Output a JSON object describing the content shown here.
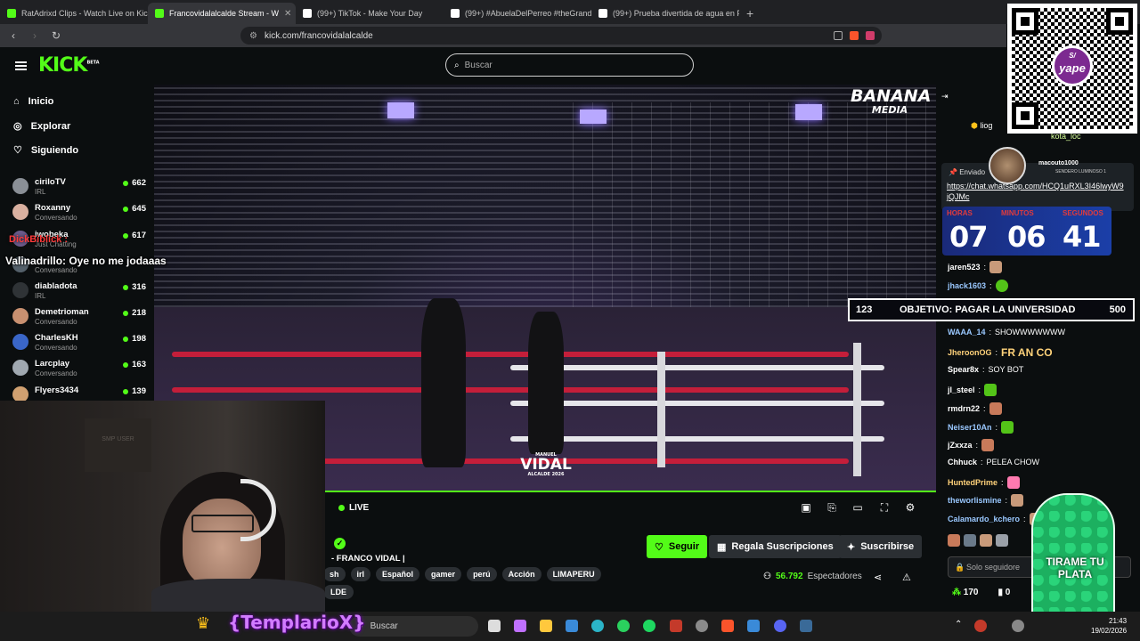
{
  "browser": {
    "tabs": [
      {
        "title": "RatAdrixd Clips - Watch Live on Kick",
        "color": "#53fc18",
        "active": false
      },
      {
        "title": "Francovidalalcalde Stream - W",
        "color": "#53fc18",
        "active": true
      },
      {
        "title": "(99+) TikTok - Make Your Day",
        "color": "#ffffff",
        "active": false
      },
      {
        "title": "(99+) #AbuelaDelPerreo #theGrandm",
        "color": "#ffffff",
        "active": false
      },
      {
        "title": "(99+) Prueba divertida de agua en Pe",
        "color": "#ffffff",
        "active": false
      }
    ],
    "url": "kick.com/francovidalalcalde"
  },
  "kick": {
    "logo": "KICK",
    "logo_badge": "BETA",
    "search_placeholder": "Buscar",
    "nav": [
      {
        "label": "Inicio",
        "icon": "home-icon"
      },
      {
        "label": "Explorar",
        "icon": "compass-icon"
      },
      {
        "label": "Siguiendo",
        "icon": "heart-icon"
      }
    ],
    "channels": [
      {
        "name": "ciriloTV",
        "sub": "IRL",
        "viewers": "662",
        "color": "#8a8f96"
      },
      {
        "name": "Roxanny",
        "sub": "Conversando",
        "viewers": "645",
        "color": "#d9b0a0"
      },
      {
        "name": "iwobeka",
        "sub": "Just Chatting",
        "viewers": "617",
        "color": "#6a5a8a"
      },
      {
        "name": "",
        "sub": "Conversando",
        "viewers": "",
        "color": "#54606a"
      },
      {
        "name": "diabladota",
        "sub": "IRL",
        "viewers": "316",
        "color": "#2f3336"
      },
      {
        "name": "Demetrioman",
        "sub": "Conversando",
        "viewers": "218",
        "color": "#c89070"
      },
      {
        "name": "CharlesKH",
        "sub": "Conversando",
        "viewers": "198",
        "color": "#3a66c8"
      },
      {
        "name": "Larcplay",
        "sub": "Conversando",
        "viewers": "163",
        "color": "#a0a8b0"
      },
      {
        "name": "Flyers3434",
        "sub": "",
        "viewers": "139",
        "color": "#d0a070"
      }
    ]
  },
  "video": {
    "watermark_top": "BANANA",
    "watermark_bottom": "MEDIA",
    "vidal_small_top": "MANUEL",
    "vidal_big": "VIDAL",
    "vidal_small_bottom": "ALCALDE 2026",
    "live_label": "LIVE"
  },
  "stream": {
    "title": "- FRANCO VIDAL |",
    "tags": [
      "sh",
      "irl",
      "Español",
      "gamer",
      "perú",
      "Acción",
      "LIMAPERU"
    ],
    "tag_extra": "LDE",
    "follow": "Seguir",
    "gift": "Regala Suscripciones",
    "subscribe": "Suscribirse",
    "viewers": "56.792",
    "viewers_label": "Espectadores"
  },
  "chat": {
    "pinned_header": "Enviado",
    "pinned_link": "https://chat.whatsapp.com/HCQ1uRXL3I46lwyW9jQJMc",
    "top_user": "liog",
    "top_user2": "kota_loc",
    "messages": [
      {
        "user": "jaren523",
        "text": "",
        "color": "#ffffff",
        "emote": "#c89a7a"
      },
      {
        "user": "jhack1603",
        "text": "",
        "color": "#9ac8ff",
        "emote": "#53c418"
      },
      {
        "user": "WAAA_14",
        "text": "SHOWWWWWWW",
        "color": "#9ac8ff",
        "emote": ""
      },
      {
        "user": "JheroonOG",
        "text": "FR AN CO",
        "color": "#ffd27a",
        "emote": ""
      },
      {
        "user": "Spear8x",
        "text": "SOY BOT",
        "color": "#ffffff",
        "emote": ""
      },
      {
        "user": "jl_steel",
        "text": "",
        "color": "#ffffff",
        "emote": "#53c418"
      },
      {
        "user": "rmdrn22",
        "text": "",
        "color": "#ffffff",
        "emote": "#c87a5a"
      },
      {
        "user": "Neiser10An",
        "text": "",
        "color": "#9ac8ff",
        "emote": "#53c418"
      },
      {
        "user": "jZxxza",
        "text": "",
        "color": "#ffffff",
        "emote": "#c87a5a"
      },
      {
        "user": "Chhuck",
        "text": "PELEA CHOW",
        "color": "#ffffff",
        "emote": ""
      },
      {
        "user": "HuntedPrime",
        "text": "",
        "color": "#ffd27a",
        "emote": "#ff7ab0"
      },
      {
        "user": "theworlismine",
        "text": "",
        "color": "#9ac8ff",
        "emote": "#c89a7a"
      },
      {
        "user": "Calamardo_kchero",
        "text": "",
        "color": "#9ac8ff",
        "emote": "#c89a7a"
      }
    ],
    "input_placeholder": "Solo seguidore",
    "points": "170",
    "count": "0"
  },
  "overlay": {
    "yape_top": "S/",
    "yape": "yape",
    "timer_labels": [
      "HORAS",
      "MINUTOS",
      "SEGUNDOS"
    ],
    "timer": [
      "07",
      "06",
      "41"
    ],
    "goal_current": "123",
    "goal_text": "OBJETIVO: PAGAR LA UNIVERSIDAD",
    "goal_target": "500",
    "alert_user": "DickBiblick",
    "alert_message": "Valinadrillo: Oye no me jodaaas",
    "macout_name": "macouto1000",
    "macout_sub": "SENDERO LUMINOSO 1",
    "webcam_sign": "SMP USER",
    "templario": "{TemplarioX}",
    "cactus_text": "TIRAME TU PLATA"
  },
  "taskbar": {
    "search": "Buscar",
    "time": "21:43",
    "date": "19/02/2026"
  }
}
